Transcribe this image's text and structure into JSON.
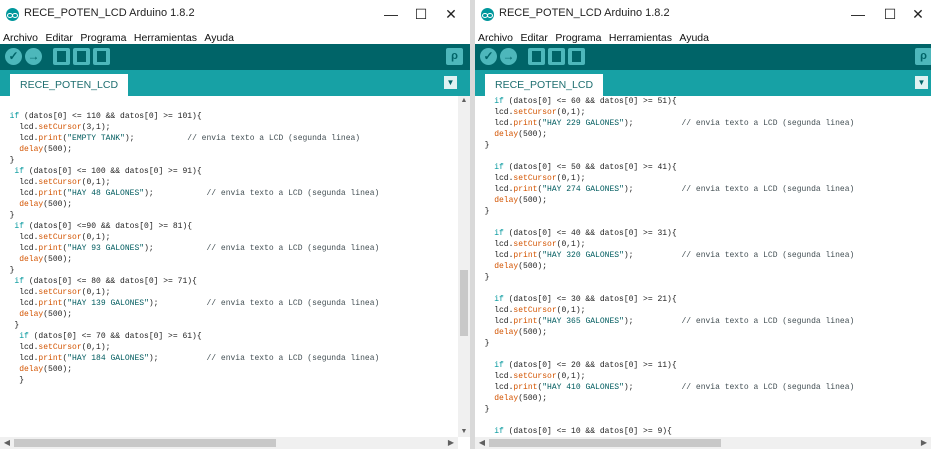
{
  "window_title": "RECE_POTEN_LCD Arduino 1.8.2",
  "window_controls": {
    "minimize": "—",
    "maximize": "☐",
    "close": "✕"
  },
  "menu": [
    "Archivo",
    "Editar",
    "Programa",
    "Herramientas",
    "Ayuda"
  ],
  "tab_label": "RECE_POTEN_LCD",
  "left_code": [
    "",
    "  if (datos[0] <= 110 && datos[0] >= 101){",
    "    lcd.setCursor(3,1);",
    "    lcd.print(\"EMPTY TANK\");           // envia texto a LCD (segunda linea)",
    "    delay(500);",
    "  }",
    "   if (datos[0] <= 100 && datos[0] >= 91){",
    "    lcd.setCursor(0,1);",
    "    lcd.print(\"HAY 48 GALONES\");           // envia texto a LCD (segunda linea)",
    "    delay(500);",
    "  }",
    "   if (datos[0] <=90 && datos[0] >= 81){",
    "    lcd.setCursor(0,1);",
    "    lcd.print(\"HAY 93 GALONES\");           // envia texto a LCD (segunda linea)",
    "    delay(500);",
    "  }",
    "   if (datos[0] <= 80 && datos[0] >= 71){",
    "    lcd.setCursor(0,1);",
    "    lcd.print(\"HAY 139 GALONES\");          // envia texto a LCD (segunda linea)",
    "    delay(500);",
    "   }",
    "    if (datos[0] <= 70 && datos[0] >= 61){",
    "    lcd.setCursor(0,1);",
    "    lcd.print(\"HAY 184 GALONES\");          // envia texto a LCD (segunda linea)",
    "    delay(500);",
    "    }"
  ],
  "right_code": [
    "    if (datos[0] <= 60 && datos[0] >= 51){",
    "    lcd.setCursor(0,1);",
    "    lcd.print(\"HAY 229 GALONES\");          // envia texto a LCD (segunda linea)",
    "    delay(500);",
    "  }",
    "",
    "    if (datos[0] <= 50 && datos[0] >= 41){",
    "    lcd.setCursor(0,1);",
    "    lcd.print(\"HAY 274 GALONES\");          // envia texto a LCD (segunda linea)",
    "    delay(500);",
    "  }",
    "",
    "    if (datos[0] <= 40 && datos[0] >= 31){",
    "    lcd.setCursor(0,1);",
    "    lcd.print(\"HAY 320 GALONES\");          // envia texto a LCD (segunda linea)",
    "    delay(500);",
    "  }",
    "",
    "    if (datos[0] <= 30 && datos[0] >= 21){",
    "    lcd.setCursor(0,1);",
    "    lcd.print(\"HAY 365 GALONES\");          // envia texto a LCD (segunda linea)",
    "    delay(500);",
    "  }",
    "",
    "    if (datos[0] <= 20 && datos[0] >= 11){",
    "    lcd.setCursor(0,1);",
    "    lcd.print(\"HAY 410 GALONES\");          // envia texto a LCD (segunda linea)",
    "    delay(500);",
    "  }",
    "",
    "    if (datos[0] <= 10 && datos[0] >= 9){"
  ],
  "colors": {
    "toolbar": "#006468",
    "tabbar": "#17a1a5",
    "button": "#4db7bb",
    "keyword": "#00979c",
    "function": "#d35400",
    "string": "#005c5f",
    "comment": "#434f54"
  }
}
